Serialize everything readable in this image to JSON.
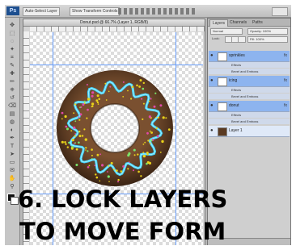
{
  "app": {
    "logo": "Ps",
    "options": [
      "Auto-Select Layer",
      "Show Transform Controls"
    ],
    "document_title": "Donut.psd @ 66.7% (Layer 1, RGB/8)"
  },
  "toolbox": {
    "icons": [
      "move-icon",
      "marquee-icon",
      "lasso-icon",
      "magic-wand-icon",
      "crop-icon",
      "eyedropper-icon",
      "healing-icon",
      "brush-icon",
      "stamp-icon",
      "history-brush-icon",
      "eraser-icon",
      "gradient-icon",
      "blur-icon",
      "dodge-icon",
      "pen-icon",
      "type-icon",
      "path-select-icon",
      "shape-icon",
      "notes-icon",
      "hand-icon",
      "zoom-icon"
    ]
  },
  "layers_panel": {
    "tabs": [
      "Layers",
      "Channels",
      "Paths"
    ],
    "blend_mode": "Normal",
    "opacity": "Opacity: 100%",
    "lock_label": "Lock:",
    "fill": "Fill: 100%",
    "layers": [
      {
        "name": "sprinkles",
        "fx": "fx",
        "effects": [
          "Effects",
          "Bevel and Emboss"
        ]
      },
      {
        "name": "icing",
        "fx": "fx",
        "effects": [
          "Effects",
          "Bevel and Emboss"
        ]
      },
      {
        "name": "donut",
        "fx": "fx",
        "effects": [
          "Effects",
          "Bevel and Emboss"
        ]
      },
      {
        "name": "Layer 1",
        "fx": ""
      }
    ]
  },
  "caption": {
    "line1": "6. LOCK LAYERS",
    "line2": "TO MOVE FORM"
  },
  "colors": {
    "donut": "#5a3a22",
    "icing_blue": "#3fd0ff",
    "sprinkle_yellow": "#e8d21a",
    "sprinkle_pink": "#e04aa8",
    "selected_layer": "#8db4ef"
  }
}
